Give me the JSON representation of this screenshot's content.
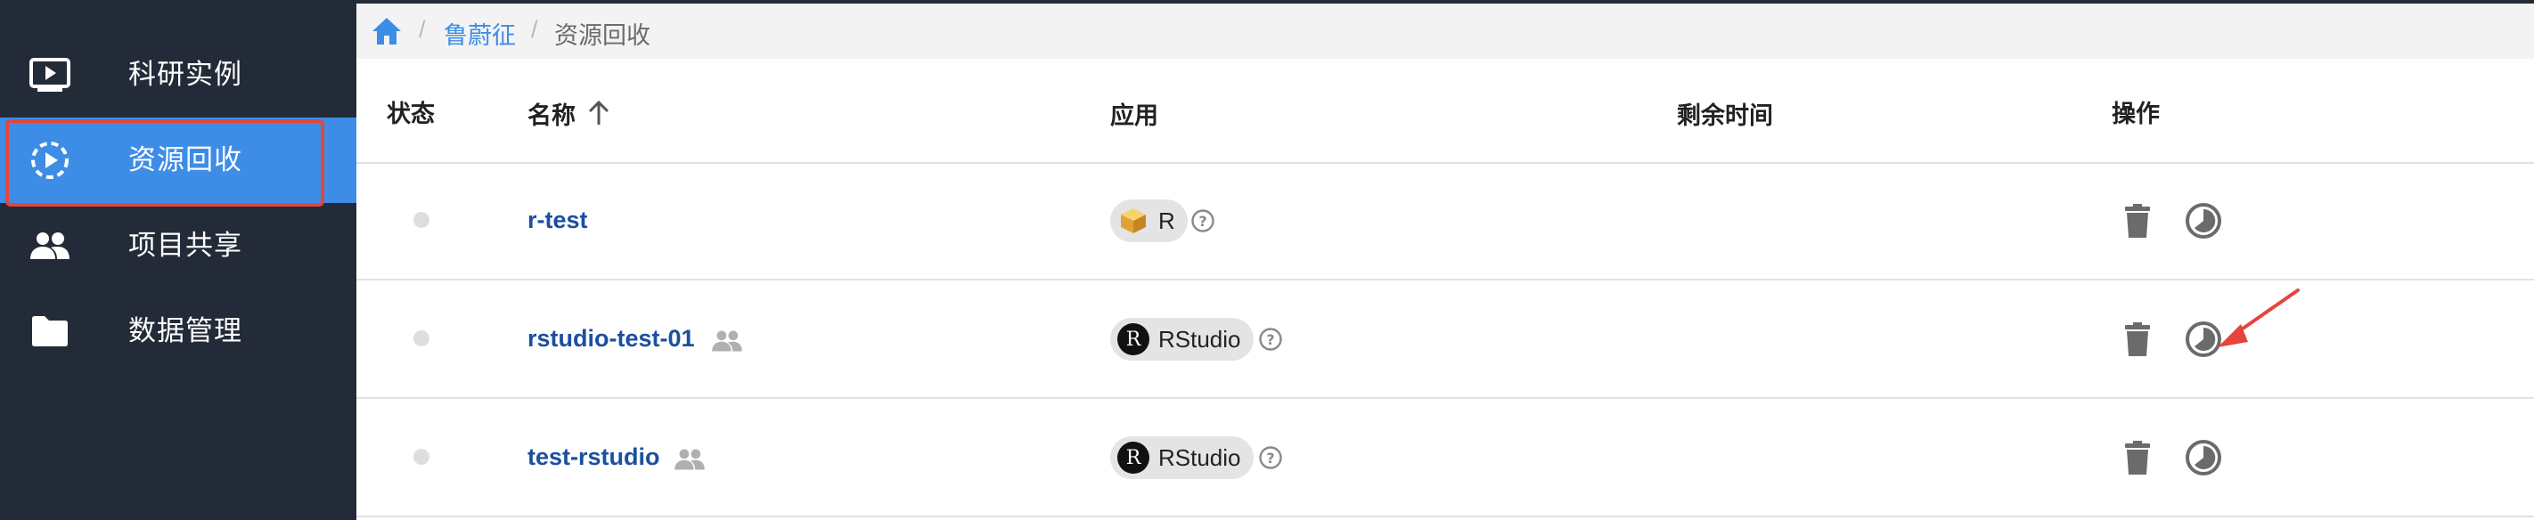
{
  "sidebar": {
    "items": [
      {
        "label": "科研实例",
        "icon": "play-screen-icon",
        "active": false
      },
      {
        "label": "资源回收",
        "icon": "recycle-play-icon",
        "active": true
      },
      {
        "label": "项目共享",
        "icon": "people-icon",
        "active": false
      },
      {
        "label": "数据管理",
        "icon": "folder-icon",
        "active": false
      }
    ]
  },
  "breadcrumb": {
    "home_icon": "home-icon",
    "separator": "/",
    "link": "鲁蔚征",
    "current": "资源回收"
  },
  "table": {
    "headers": {
      "status": "状态",
      "name": "名称",
      "app": "应用",
      "remaining": "剩余时间",
      "actions": "操作"
    },
    "sort": {
      "column": "name",
      "direction": "ascending",
      "icon": "arrow-up-icon"
    },
    "rows": [
      {
        "name": "r-test",
        "shared": false,
        "app": "R",
        "app_icon": "r-app-icon",
        "remaining": ""
      },
      {
        "name": "rstudio-test-01",
        "shared": true,
        "app": "RStudio",
        "app_icon": "rstudio-icon",
        "remaining": ""
      },
      {
        "name": "test-rstudio",
        "shared": true,
        "app": "RStudio",
        "app_icon": "rstudio-icon",
        "remaining": ""
      }
    ],
    "action_icons": [
      "trash-icon",
      "timer-icon"
    ]
  },
  "annotation": {
    "type": "red-arrow",
    "points_to": "rows.1.timer"
  },
  "colors": {
    "sidebar_bg": "#232b38",
    "active_bg": "#3d8de6",
    "highlight_border": "#e5453a",
    "link": "#1c4fa0",
    "breadcrumb_link": "#3d8de6",
    "chip_bg": "#e4e4e4",
    "icon_gray": "#6b6b6b"
  }
}
